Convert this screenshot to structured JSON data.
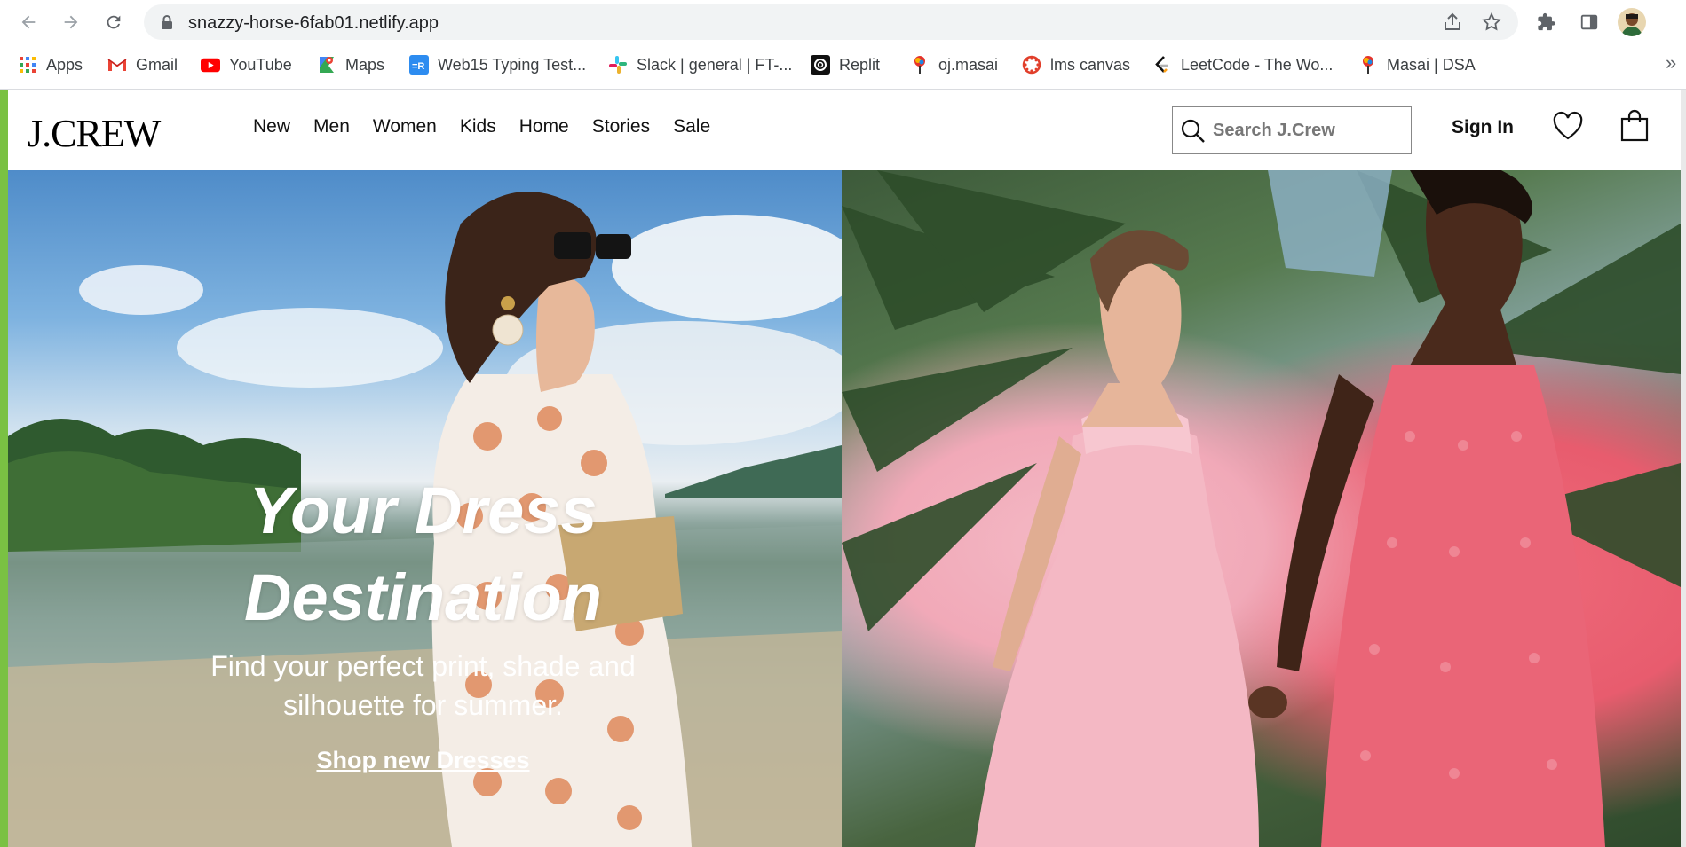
{
  "browser": {
    "url": "snazzy-horse-6fab01.netlify.app",
    "bookmarks": [
      {
        "label": "Apps",
        "icon": "apps-grid-icon"
      },
      {
        "label": "Gmail",
        "icon": "gmail-icon"
      },
      {
        "label": "YouTube",
        "icon": "youtube-icon"
      },
      {
        "label": "Maps",
        "icon": "maps-icon"
      },
      {
        "label": "Web15 Typing Test...",
        "icon": "web15-icon"
      },
      {
        "label": "Slack | general | FT-...",
        "icon": "slack-icon"
      },
      {
        "label": "Replit",
        "icon": "replit-icon"
      },
      {
        "label": "oj.masai",
        "icon": "masai-icon"
      },
      {
        "label": "lms canvas",
        "icon": "canvas-icon"
      },
      {
        "label": "LeetCode - The Wo...",
        "icon": "leetcode-icon"
      },
      {
        "label": "Masai | DSA",
        "icon": "masai-icon"
      }
    ],
    "more_label": "»"
  },
  "site": {
    "logo": "J.CREW",
    "nav": [
      "New",
      "Men",
      "Women",
      "Kids",
      "Home",
      "Stories",
      "Sale"
    ],
    "search_placeholder": "Search J.Crew",
    "sign_in": "Sign In"
  },
  "hero": {
    "title_line1": "Your Dress",
    "title_line2": "Destination",
    "subtitle_line1": "Find your perfect print, shade and",
    "subtitle_line2": "silhouette for summer.",
    "cta": "Shop new Dresses"
  },
  "colors": {
    "left_edge_accent": "#7ac143",
    "chrome_bg": "#f1f3f4"
  }
}
